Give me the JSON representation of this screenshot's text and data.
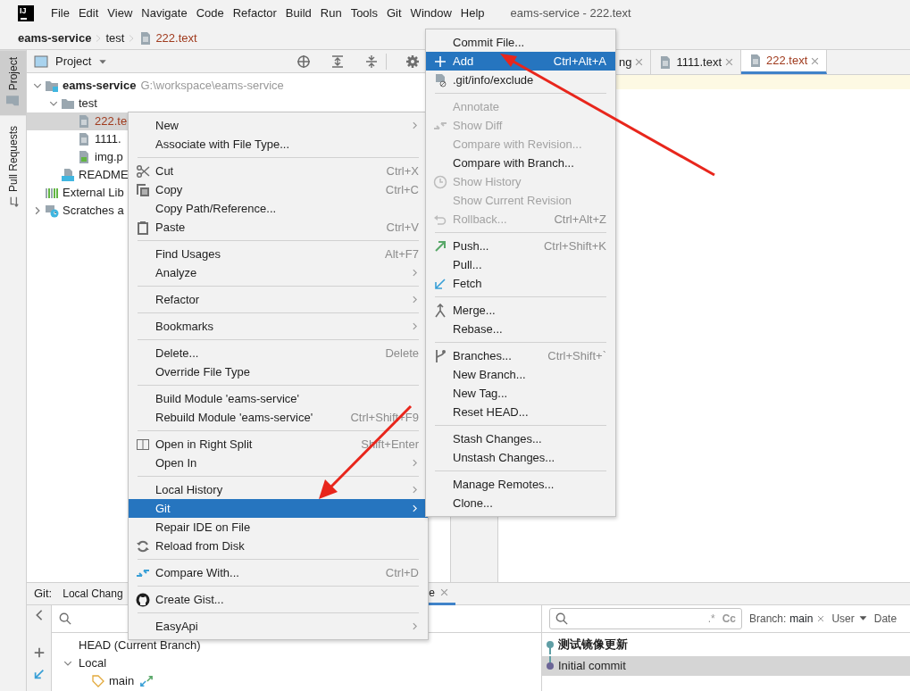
{
  "menubar": {
    "logo_text": "IJ",
    "items": [
      "File",
      "Edit",
      "View",
      "Navigate",
      "Code",
      "Refactor",
      "Build",
      "Run",
      "Tools",
      "Git",
      "Window",
      "Help"
    ],
    "title": "eams-service - 222.text"
  },
  "breadcrumb": [
    {
      "label": "eams-service",
      "unversioned": false
    },
    {
      "label": "test",
      "unversioned": false
    },
    {
      "label": "222.text",
      "kind": "text",
      "unversioned": true
    }
  ],
  "tool_strip": [
    {
      "label": "Project",
      "kind": "folder",
      "selected": true
    },
    {
      "label": "Pull Requests",
      "kind": "pull",
      "selected": false
    }
  ],
  "project_panel": {
    "title": "Project",
    "tree": [
      {
        "label": "eams-service",
        "path": "G:\\workspace\\eams-service",
        "kind": "module",
        "expanded": true,
        "selected": false,
        "unversioned": false,
        "children": [
          {
            "label": "test",
            "kind": "folder",
            "expanded": true,
            "selected": false,
            "unversioned": false,
            "children": [
              {
                "label": "222.te",
                "kind": "text",
                "selected": true,
                "unversioned": true
              },
              {
                "label": "1111.",
                "kind": "text",
                "selected": false,
                "unversioned": false
              },
              {
                "label": "img.p",
                "kind": "image",
                "selected": false,
                "unversioned": false
              }
            ]
          },
          {
            "label": "README",
            "kind": "markdown",
            "selected": false,
            "unversioned": false
          }
        ]
      },
      {
        "label": "External Lib",
        "kind": "library",
        "selected": false,
        "unversioned": false
      },
      {
        "label": "Scratches a",
        "kind": "scratch",
        "expanded": false,
        "selected": false,
        "unversioned": false
      }
    ]
  },
  "editor_tabs": [
    {
      "label": "ng",
      "selected": false,
      "unversioned": false
    },
    {
      "label": "1111.text",
      "kind": "text",
      "selected": false,
      "unversioned": false
    },
    {
      "label": "222.text",
      "kind": "text",
      "selected": true,
      "unversioned": true
    }
  ],
  "context_menu": [
    [
      {
        "label": "New",
        "submenu": true,
        "selected": false
      },
      {
        "label": "Associate with File Type...",
        "submenu": false,
        "selected": false
      }
    ],
    [
      {
        "label": "Cut",
        "kind": "cut",
        "shortcut": "Ctrl+X",
        "submenu": false,
        "selected": false
      },
      {
        "label": "Copy",
        "kind": "copy",
        "shortcut": "Ctrl+C",
        "submenu": false,
        "selected": false
      },
      {
        "label": "Copy Path/Reference...",
        "submenu": false,
        "selected": false
      },
      {
        "label": "Paste",
        "kind": "paste",
        "shortcut": "Ctrl+V",
        "submenu": false,
        "selected": false
      }
    ],
    [
      {
        "label": "Find Usages",
        "shortcut": "Alt+F7",
        "submenu": false,
        "selected": false
      },
      {
        "label": "Analyze",
        "submenu": true,
        "selected": false
      }
    ],
    [
      {
        "label": "Refactor",
        "submenu": true,
        "selected": false
      }
    ],
    [
      {
        "label": "Bookmarks",
        "submenu": true,
        "selected": false
      }
    ],
    [
      {
        "label": "Delete...",
        "shortcut": "Delete",
        "submenu": false,
        "selected": false
      },
      {
        "label": "Override File Type",
        "submenu": false,
        "selected": false
      }
    ],
    [
      {
        "label": "Build Module 'eams-service'",
        "submenu": false,
        "selected": false
      },
      {
        "label": "Rebuild Module 'eams-service'",
        "shortcut": "Ctrl+Shift+F9",
        "submenu": false,
        "selected": false
      }
    ],
    [
      {
        "label": "Open in Right Split",
        "kind": "split",
        "shortcut": "Shift+Enter",
        "submenu": false,
        "selected": false
      },
      {
        "label": "Open In",
        "submenu": true,
        "selected": false
      }
    ],
    [
      {
        "label": "Local History",
        "submenu": true,
        "selected": false
      },
      {
        "label": "Git",
        "submenu": true,
        "selected": true
      },
      {
        "label": "Repair IDE on File",
        "submenu": false,
        "selected": false
      },
      {
        "label": "Reload from Disk",
        "kind": "reload",
        "submenu": false,
        "selected": false
      }
    ],
    [
      {
        "label": "Compare With...",
        "kind": "compare",
        "shortcut": "Ctrl+D",
        "submenu": false,
        "selected": false
      }
    ],
    [
      {
        "label": "Create Gist...",
        "kind": "gist",
        "submenu": false,
        "selected": false
      }
    ],
    [
      {
        "label": "EasyApi",
        "submenu": true,
        "selected": false
      }
    ]
  ],
  "git_submenu": [
    [
      {
        "label": "Commit File...",
        "disabled": false,
        "selected": false
      },
      {
        "label": "Add",
        "kind": "plus",
        "shortcut": "Ctrl+Alt+A",
        "disabled": false,
        "selected": true
      },
      {
        "label": ".git/info/exclude",
        "kind": "exclude",
        "disabled": false,
        "selected": false
      }
    ],
    [
      {
        "label": "Annotate",
        "disabled": true,
        "selected": false
      },
      {
        "label": "Show Diff",
        "kind": "diff",
        "disabled": true,
        "selected": false
      },
      {
        "label": "Compare with Revision...",
        "disabled": true,
        "selected": false
      },
      {
        "label": "Compare with Branch...",
        "disabled": false,
        "selected": false
      },
      {
        "label": "Show History",
        "kind": "history",
        "disabled": true,
        "selected": false
      },
      {
        "label": "Show Current Revision",
        "disabled": true,
        "selected": false
      },
      {
        "label": "Rollback...",
        "kind": "undo",
        "shortcut": "Ctrl+Alt+Z",
        "disabled": true,
        "selected": false
      }
    ],
    [
      {
        "label": "Push...",
        "kind": "push",
        "shortcut": "Ctrl+Shift+K",
        "disabled": false,
        "selected": false
      },
      {
        "label": "Pull...",
        "disabled": false,
        "selected": false
      },
      {
        "label": "Fetch",
        "kind": "fetch",
        "disabled": false,
        "selected": false
      }
    ],
    [
      {
        "label": "Merge...",
        "kind": "merge",
        "disabled": false,
        "selected": false
      },
      {
        "label": "Rebase...",
        "disabled": false,
        "selected": false
      }
    ],
    [
      {
        "label": "Branches...",
        "kind": "branch",
        "shortcut": "Ctrl+Shift+`",
        "disabled": false,
        "selected": false
      },
      {
        "label": "New Branch...",
        "disabled": false,
        "selected": false
      },
      {
        "label": "New Tag...",
        "disabled": false,
        "selected": false
      },
      {
        "label": "Reset HEAD...",
        "disabled": false,
        "selected": false
      }
    ],
    [
      {
        "label": "Stash Changes...",
        "disabled": false,
        "selected": false
      },
      {
        "label": "Unstash Changes...",
        "disabled": false,
        "selected": false
      }
    ],
    [
      {
        "label": "Manage Remotes...",
        "disabled": false,
        "selected": false
      },
      {
        "label": "Clone...",
        "disabled": false,
        "selected": false
      }
    ]
  ],
  "git_panel": {
    "label": "Git:",
    "tabs": [
      {
        "label": "Local Chang",
        "selected": false
      },
      {
        "label": "e",
        "selected": true
      }
    ],
    "branches": [
      {
        "label": "HEAD (Current Branch)",
        "selected": false
      },
      {
        "label": "Local",
        "expanded": true,
        "selected": false,
        "children": [
          {
            "label": "main",
            "kind": "tag",
            "selected": false
          }
        ]
      }
    ],
    "log_filters": [
      {
        "label": "Branch:",
        "value": "main",
        "kind": "clearable"
      },
      {
        "label": "User",
        "kind": "dropdown"
      },
      {
        "label": "Date",
        "kind": "dropdown"
      }
    ],
    "log_search": {
      "regex": ".*",
      "match_case": "Cc"
    },
    "commits": [
      {
        "message": "测试镜像更新",
        "head": true,
        "selected": false,
        "color": "#5f9ea5"
      },
      {
        "message": "Initial commit",
        "head": false,
        "selected": true,
        "color": "#6b6597"
      }
    ]
  }
}
